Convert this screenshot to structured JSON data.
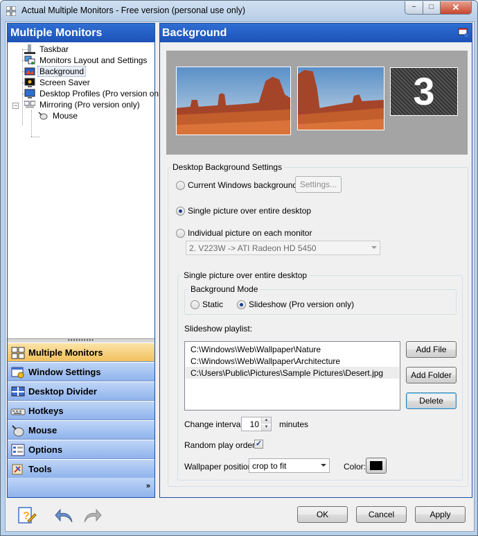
{
  "window": {
    "title": "Actual Multiple Monitors - Free version (personal use only)",
    "controls": {
      "minimize": "−",
      "maximize": "□",
      "close": "✕"
    }
  },
  "left_panel": {
    "header": "Multiple Monitors",
    "tree": [
      {
        "label": "Taskbar",
        "icon": "taskbar-icon"
      },
      {
        "label": "Monitors Layout and Settings",
        "icon": "monitors-layout-icon"
      },
      {
        "label": "Background",
        "icon": "background-icon",
        "selected": true
      },
      {
        "label": "Screen Saver",
        "icon": "screen-saver-icon"
      },
      {
        "label": "Desktop Profiles (Pro version only)",
        "icon": "desktop-profiles-icon"
      },
      {
        "label": "Mirroring (Pro version only)",
        "icon": "mirroring-icon",
        "expanded": true
      },
      {
        "label": "Mouse",
        "icon": "mouse-icon"
      }
    ],
    "splitter_grip": "••••••••••",
    "nav": [
      {
        "label": "Multiple Monitors",
        "icon": "monitors-icon",
        "active": true
      },
      {
        "label": "Window Settings",
        "icon": "window-settings-icon"
      },
      {
        "label": "Desktop Divider",
        "icon": "desktop-divider-icon"
      },
      {
        "label": "Hotkeys",
        "icon": "keyboard-icon"
      },
      {
        "label": "Mouse",
        "icon": "mouse-icon"
      },
      {
        "label": "Options",
        "icon": "options-icon"
      },
      {
        "label": "Tools",
        "icon": "tools-icon"
      }
    ],
    "more_glyph": "»"
  },
  "right_panel": {
    "header": "Background",
    "preview": {
      "monitor_3_label": "3"
    },
    "desktop_bg_group": "Desktop Background Settings",
    "radio_current": "Current Windows background",
    "settings_button": "Settings...",
    "radio_single": "Single picture over entire desktop",
    "radio_individual": "Individual picture on each monitor",
    "monitor_combo": "2. V223W -> ATI Radeon HD 5450",
    "single_group": "Single picture over entire desktop",
    "mode_group": "Background Mode",
    "mode_static": "Static",
    "mode_slideshow": "Slideshow (Pro version only)",
    "playlist_label": "Slideshow playlist:",
    "playlist": [
      "C:\\Windows\\Web\\Wallpaper\\Nature",
      "C:\\Windows\\Web\\Wallpaper\\Architecture",
      "C:\\Users\\Public\\Pictures\\Sample Pictures\\Desert.jpg"
    ],
    "add_file": "Add File",
    "add_folder": "Add Folder",
    "delete": "Delete",
    "interval_label": "Change interval:",
    "interval_value": "10",
    "interval_unit": "minutes",
    "random_label": "Random play order",
    "random_checked": "✓",
    "position_label": "Wallpaper position:",
    "position_value": "crop to fit",
    "color_label": "Color:",
    "color_value": "#000000"
  },
  "footer": {
    "ok": "OK",
    "cancel": "Cancel",
    "apply": "Apply"
  },
  "colors": {
    "header_blue": "#1d53b7",
    "nav_active": "#f1c15d",
    "preview_bg": "#a4a4a4"
  }
}
